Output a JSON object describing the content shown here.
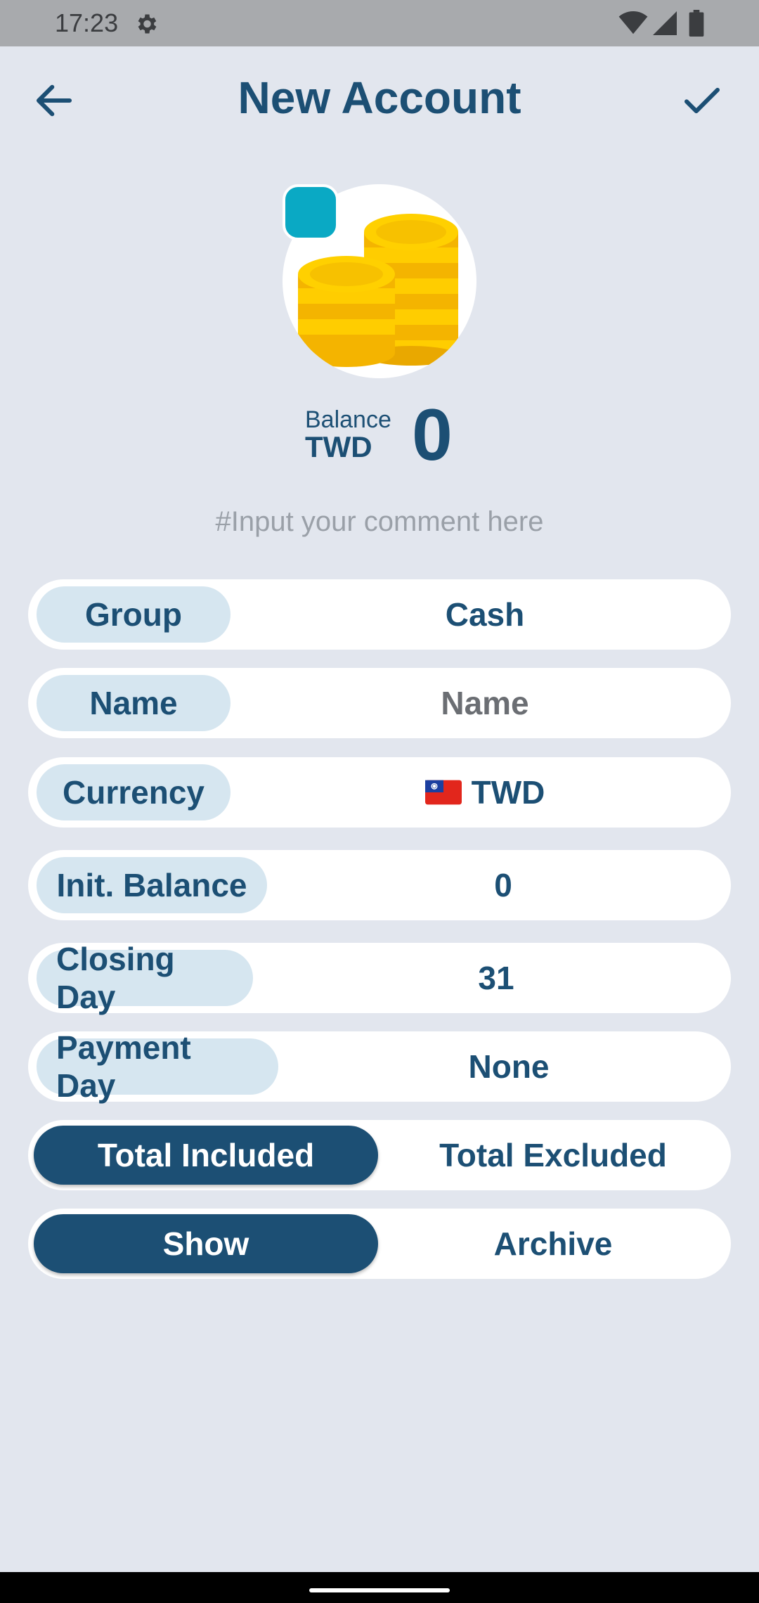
{
  "status_bar": {
    "time": "17:23",
    "icons": [
      "gear-icon",
      "wifi-icon",
      "signal-icon",
      "battery-icon"
    ]
  },
  "header": {
    "title": "New Account",
    "back_icon": "arrow-left-icon",
    "confirm_icon": "check-icon"
  },
  "avatar": {
    "icon": "coins-icon",
    "color": "#0aa9c4"
  },
  "balance": {
    "label": "Balance",
    "currency": "TWD",
    "value": "0"
  },
  "comment": {
    "placeholder": "#Input your comment here",
    "value": ""
  },
  "fields": {
    "group": {
      "label": "Group",
      "value": "Cash"
    },
    "name": {
      "label": "Name",
      "value": "",
      "placeholder": "Name"
    },
    "currency": {
      "label": "Currency",
      "flag_icon": "taiwan-flag-icon",
      "value": "TWD"
    },
    "init_balance": {
      "label": "Init. Balance",
      "value": "0"
    },
    "closing_day": {
      "label": "Closing Day",
      "value": "31"
    },
    "payment_day": {
      "label": "Payment Day",
      "value": "None"
    }
  },
  "total_toggle": {
    "options": [
      "Total Included",
      "Total Excluded"
    ],
    "selected": "Total Included"
  },
  "visibility_toggle": {
    "options": [
      "Show",
      "Archive"
    ],
    "selected": "Show"
  },
  "colors": {
    "primary": "#1c4f74",
    "background": "#e2e6ee",
    "label_chip": "#d6e6f0",
    "accent": "#0aa9c4"
  }
}
